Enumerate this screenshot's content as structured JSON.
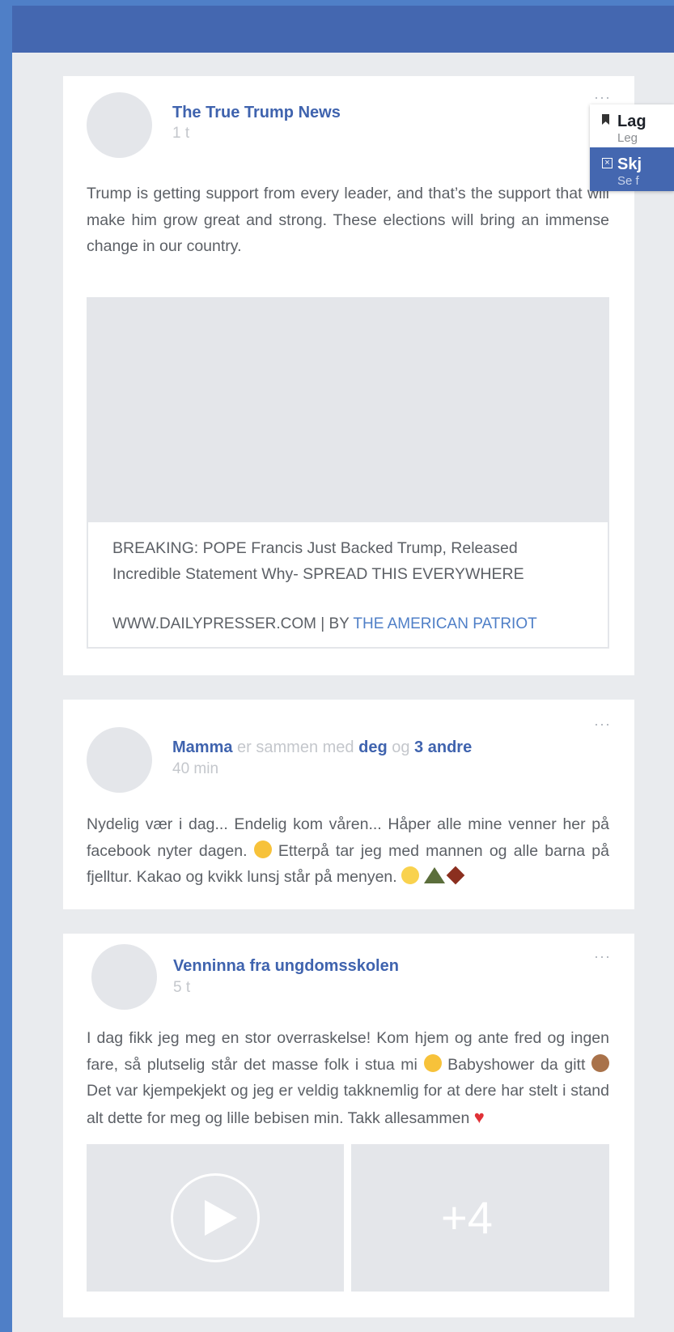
{
  "menu": {
    "items": [
      {
        "icon": "bookmark-icon",
        "title": "Lag",
        "subtitle": "Leg"
      },
      {
        "icon": "x-square-icon",
        "title": "Skj",
        "subtitle": "Se f"
      }
    ]
  },
  "posts": [
    {
      "author": "The True Trump News",
      "time": "1 t",
      "more": "···",
      "text": "Trump is getting support from every leader, and that’s the support that will make him grow great and strong. These elections will bring an immense change in our country.",
      "link": {
        "title": "BREAKING: POPE Francis Just Backed Trump, Released Incredible Statement Why- SPREAD THIS EVERYWHERE",
        "source": "WWW.DAILYPRESSER.COM | BY ",
        "author": "THE AMERICAN PATRIOT"
      }
    },
    {
      "author": "Mamma",
      "with_text": "er sammen med",
      "tag1": "deg",
      "and_text": "og",
      "tag2": "3 andre",
      "time": "40 min",
      "more": "···",
      "text_part1": "Nydelig vær i dag... Endelig kom våren... Håper alle mine venner her på facebook nyter dagen. ",
      "text_part2": " Etterpå tar jeg med mannen og alle barna på fjelltur. Kakao og kvikk lunsj står på menyen. "
    },
    {
      "author": "Venninna fra ungdomsskolen",
      "time": "5 t",
      "more": "···",
      "text_part1": "I dag fikk jeg meg en stor overraskelse! Kom hjem og ante fred og ingen fare, så plutselig står det masse folk i stua mi ",
      "text_part2": " Babyshower da gitt ",
      "text_part3": " Det var kjempekjekt og jeg er veldig takknemlig for at dere har stelt i stand alt dette for meg og lille bebisen min. Takk allesammen ",
      "more_count": "+4"
    }
  ],
  "colors": {
    "header": "#4467b0",
    "link": "#3f63ae",
    "muted": "#c4c7cc",
    "placeholder": "#e4e6ea"
  }
}
